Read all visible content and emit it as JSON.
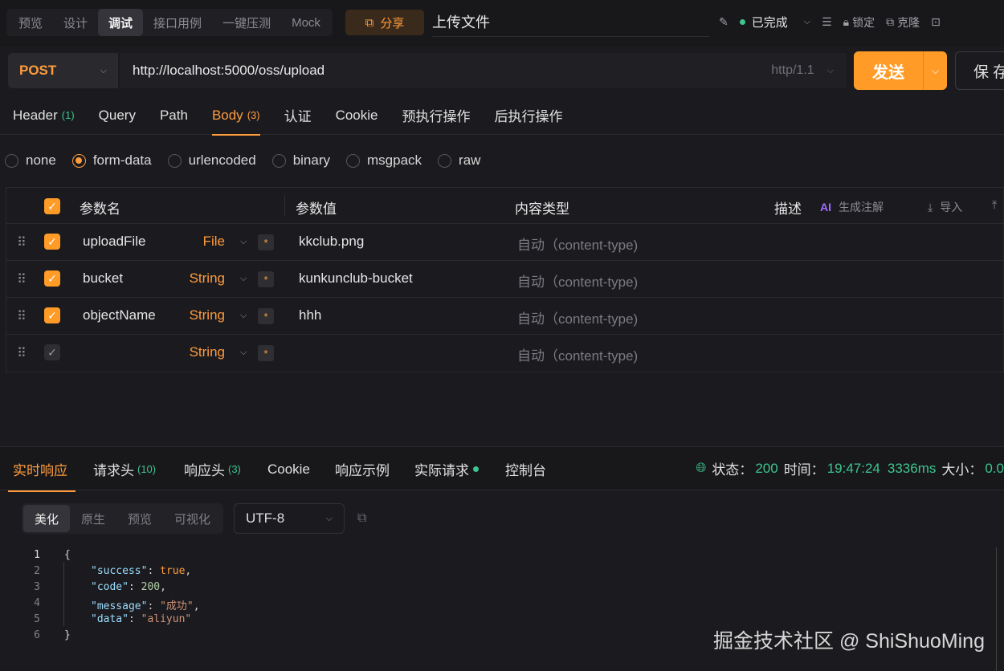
{
  "mode_tabs": [
    "预览",
    "设计",
    "调试",
    "接口用例",
    "一键压测",
    "Mock"
  ],
  "active_mode": "调试",
  "share_label": "分享",
  "doc_title": "上传文件",
  "status": {
    "state": "已完成",
    "lock": "锁定",
    "clone": "克隆"
  },
  "request": {
    "method": "POST",
    "url": "http://localhost:5000/oss/upload",
    "protocol": "http/1.1",
    "send_label": "发送",
    "save_label": "保 存"
  },
  "request_tabs": [
    {
      "label": "Header",
      "count": "(1)"
    },
    {
      "label": "Query",
      "count": ""
    },
    {
      "label": "Path",
      "count": ""
    },
    {
      "label": "Body",
      "count": "(3)"
    },
    {
      "label": "认证",
      "count": ""
    },
    {
      "label": "Cookie",
      "count": ""
    },
    {
      "label": "预执行操作",
      "count": ""
    },
    {
      "label": "后执行操作",
      "count": ""
    }
  ],
  "body_types": [
    "none",
    "form-data",
    "urlencoded",
    "binary",
    "msgpack",
    "raw"
  ],
  "selected_body_type": "form-data",
  "params_table": {
    "headers": {
      "name": "参数名",
      "value": "参数值",
      "content_type": "内容类型",
      "description": "描述",
      "ai_note": "生成注解",
      "import": "导入"
    },
    "rows": [
      {
        "name": "uploadFile",
        "type": "File",
        "value": "kkclub.png",
        "content_type": "自动（content-type)",
        "checked": true
      },
      {
        "name": "bucket",
        "type": "String",
        "value": "kunkunclub-bucket",
        "content_type": "自动（content-type)",
        "checked": true
      },
      {
        "name": "objectName",
        "type": "String",
        "value": "hhh",
        "content_type": "自动（content-type)",
        "checked": true
      },
      {
        "name": "",
        "type": "String",
        "value": "",
        "content_type": "自动（content-type)",
        "checked": false
      }
    ]
  },
  "response": {
    "tabs": [
      {
        "label": "实时响应",
        "count": ""
      },
      {
        "label": "请求头",
        "count": "(10)"
      },
      {
        "label": "响应头",
        "count": "(3)"
      },
      {
        "label": "Cookie",
        "count": ""
      },
      {
        "label": "响应示例",
        "count": ""
      },
      {
        "label": "实际请求",
        "count": ""
      },
      {
        "label": "控制台",
        "count": ""
      }
    ],
    "status_label": "状态：",
    "status_code": "200",
    "time_label": "时间：",
    "time_value": "19:47:24",
    "duration": "3336ms",
    "size_label": "大小：",
    "size_value": "0.0",
    "view_modes": [
      "美化",
      "原生",
      "预览",
      "可视化"
    ],
    "encoding": "UTF-8",
    "code_lines": [
      "1",
      "2",
      "3",
      "4",
      "5",
      "6"
    ],
    "json": {
      "open": "{",
      "close": "}",
      "k_success": "\"success\"",
      "v_success": "true",
      "k_code": "\"code\"",
      "v_code": "200",
      "k_message": "\"message\"",
      "v_message": "\"成功\"",
      "k_data": "\"data\"",
      "v_data": "\"aliyun\""
    }
  },
  "watermark": "掘金技术社区 @ ShiShuoMing",
  "colors": {
    "accent": "#ff9b26",
    "success": "#3cc58e",
    "background": "#1b1b1f"
  }
}
